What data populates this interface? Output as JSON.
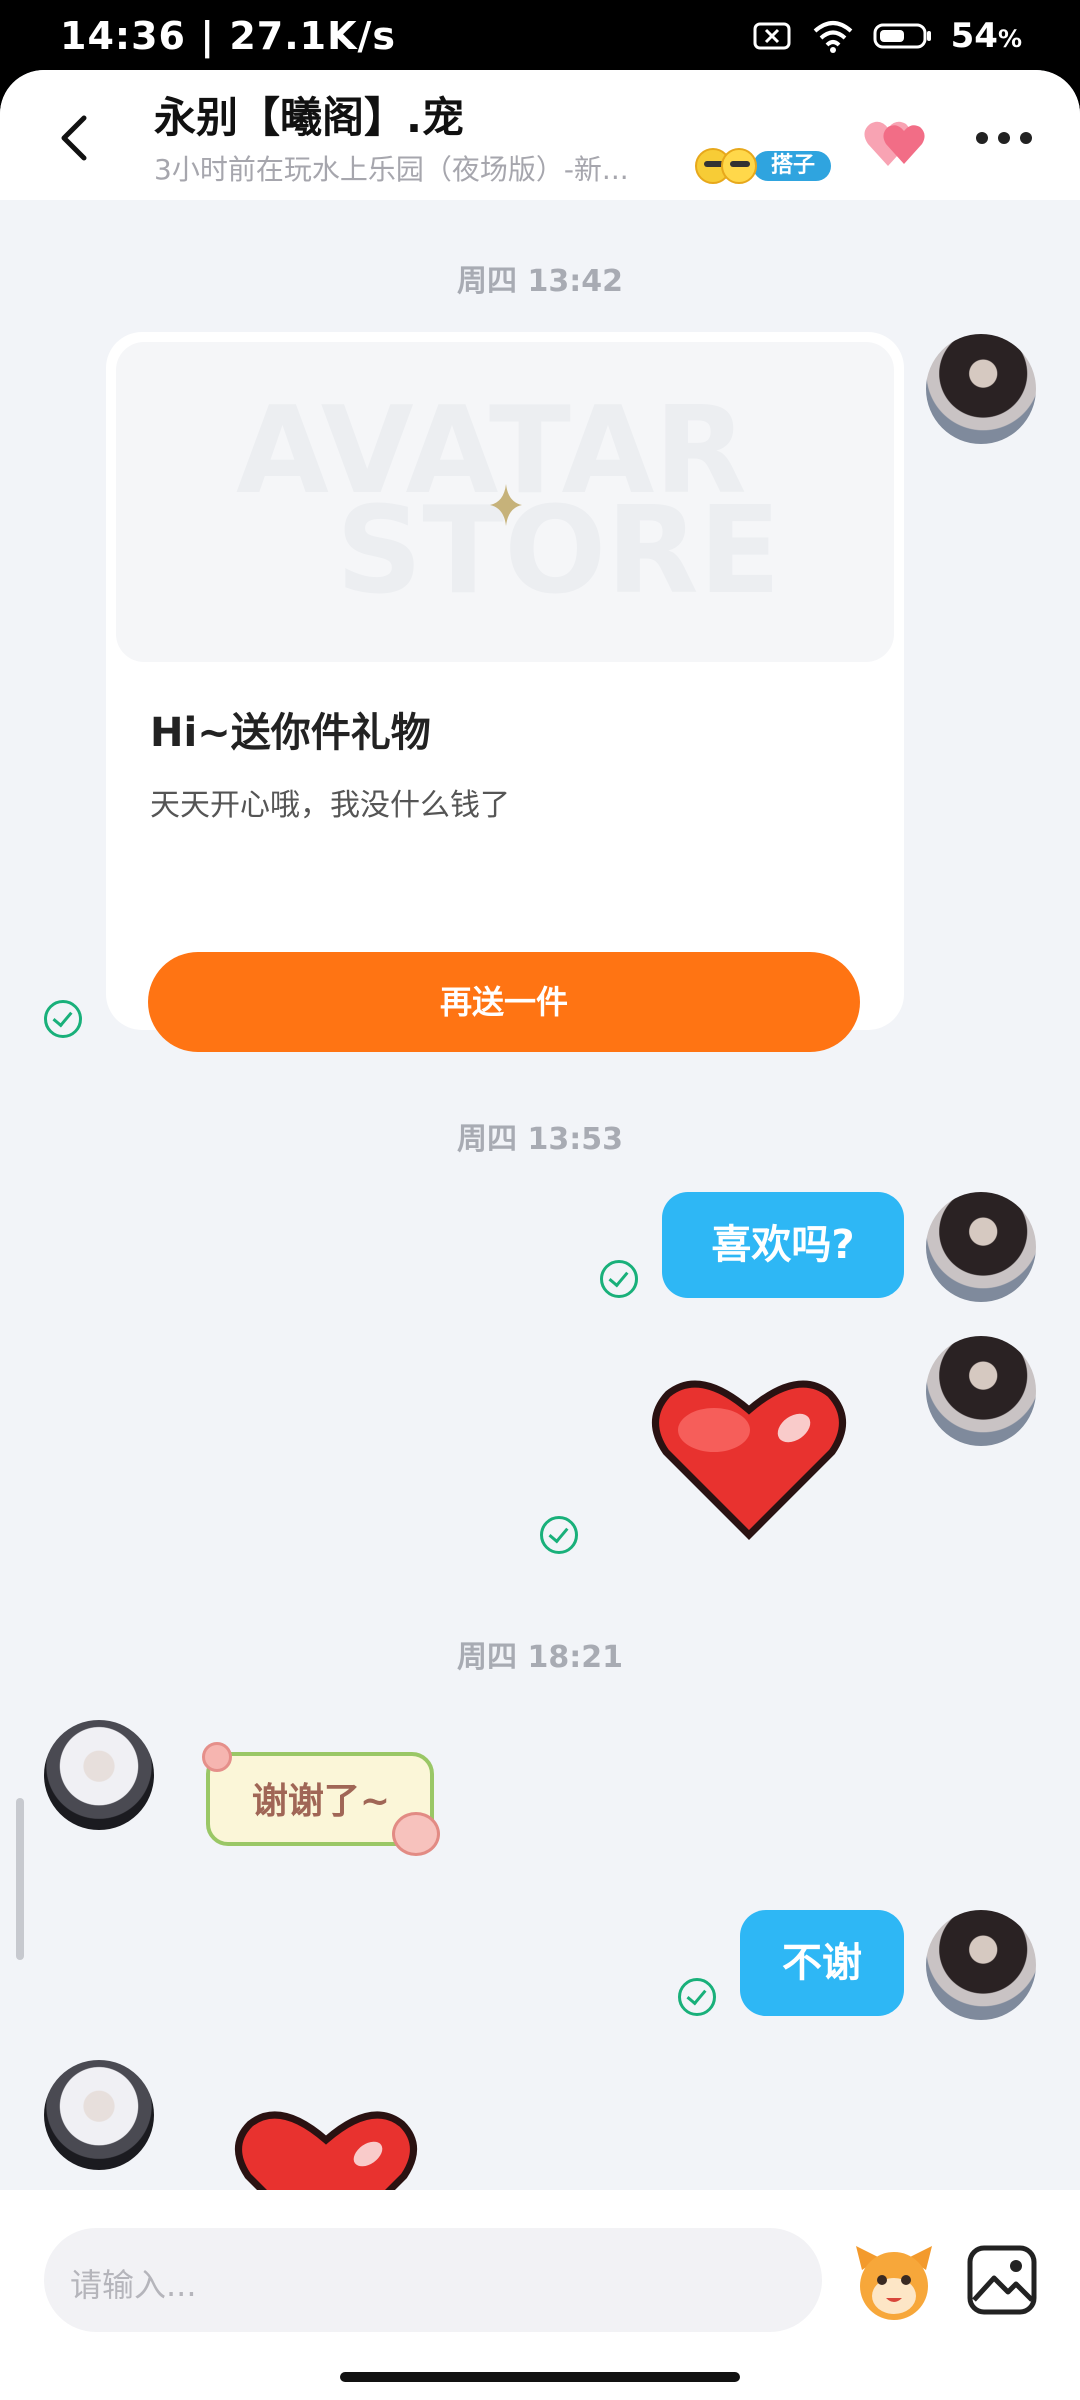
{
  "status_bar": {
    "time": "14:36",
    "network_speed": "27.1K/s",
    "battery": "54",
    "battery_unit": "%"
  },
  "header": {
    "title": "永别【曦阁】.宠",
    "subtitle": "3小时前在玩水上乐园（夜场版）-新...",
    "tag": "搭子"
  },
  "gift_card": {
    "image_watermark_line1": "AVATAR",
    "image_watermark_line2": "STORE",
    "title": "Hi~送你件礼物",
    "description": "天天开心哦，我没什么钱了",
    "button_label": "再送一件"
  },
  "messages": [
    {
      "timestamp": "周四 13:42"
    },
    {
      "timestamp": "周四 13:53"
    },
    {
      "timestamp": "周四 18:21"
    }
  ],
  "bubbles": {
    "like_it": "喜欢吗?",
    "sticker_thanks": "谢谢了~",
    "no_thanks": "不谢"
  },
  "input": {
    "placeholder": "请输入..."
  },
  "colors": {
    "accent_orange": "#ff7413",
    "bubble_blue": "#2eb7f5",
    "check_green": "#19b07a",
    "tag_blue": "#2fa4df"
  },
  "icons": [
    "back-icon",
    "heart-icon",
    "more-icon",
    "check-icon",
    "emoji-icon",
    "image-icon",
    "sim-icon",
    "wifi-icon",
    "battery-icon"
  ]
}
